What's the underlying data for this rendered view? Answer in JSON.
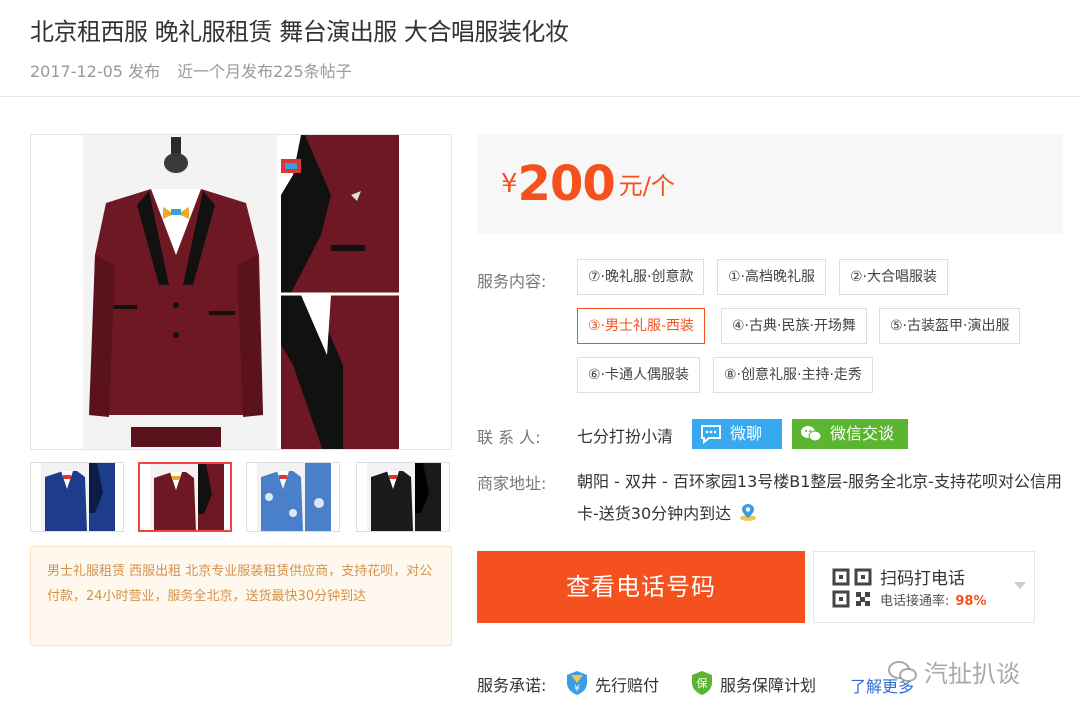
{
  "header": {
    "title": "北京租西服 晚礼服租赁 舞台演出服 大合唱服装化妆",
    "date": "2017-12-05 发布",
    "post_count": "近一个月发布225条帖子"
  },
  "gallery": {
    "thumbnails": [
      "blue-suit",
      "burgundy-suit",
      "floral-blue-suit",
      "black-suit"
    ],
    "active_index": 1
  },
  "description": "男士礼服租赁 西服出租 北京专业服装租赁供应商，支持花呗，对公付款，24小时营业，服务全北京，送货最快30分钟到达",
  "price": {
    "currency": "¥",
    "amount": "200",
    "unit": "元/个"
  },
  "services": {
    "label": "服务内容:",
    "items": [
      "⑦·晚礼服·创意款",
      "①·高档晚礼服",
      "②·大合唱服装",
      "③·男士礼服-西装",
      "④·古典·民族·开场舞",
      "⑤·古装盔甲·演出服",
      "⑥·卡通人偶服装",
      "⑧·创意礼服·主持·走秀"
    ],
    "active_index": 3
  },
  "contact": {
    "label": "联 系 人:",
    "name": "七分打扮小清",
    "weiliao_label": "微聊",
    "wechat_label": "微信交谈"
  },
  "address": {
    "label": "商家地址:",
    "text": "朝阳 -  双井  - 百环家园13号楼B1整层-服务全北京-支持花呗对公信用卡-送货30分钟内到达"
  },
  "actions": {
    "phone_button": "查看电话号码",
    "qr_title": "扫码打电话",
    "qr_sub_label": "电话接通率:",
    "qr_rate": "98%"
  },
  "promise": {
    "label": "服务承诺:",
    "item1": "先行赔付",
    "item2": "服务保障计划",
    "learn_more": "了解更多"
  },
  "watermark": "汽扯扒谈",
  "colors": {
    "accent": "#f4511e",
    "weiliao": "#38a8f0",
    "wechat": "#5cb531",
    "link": "#2a6cd4"
  }
}
